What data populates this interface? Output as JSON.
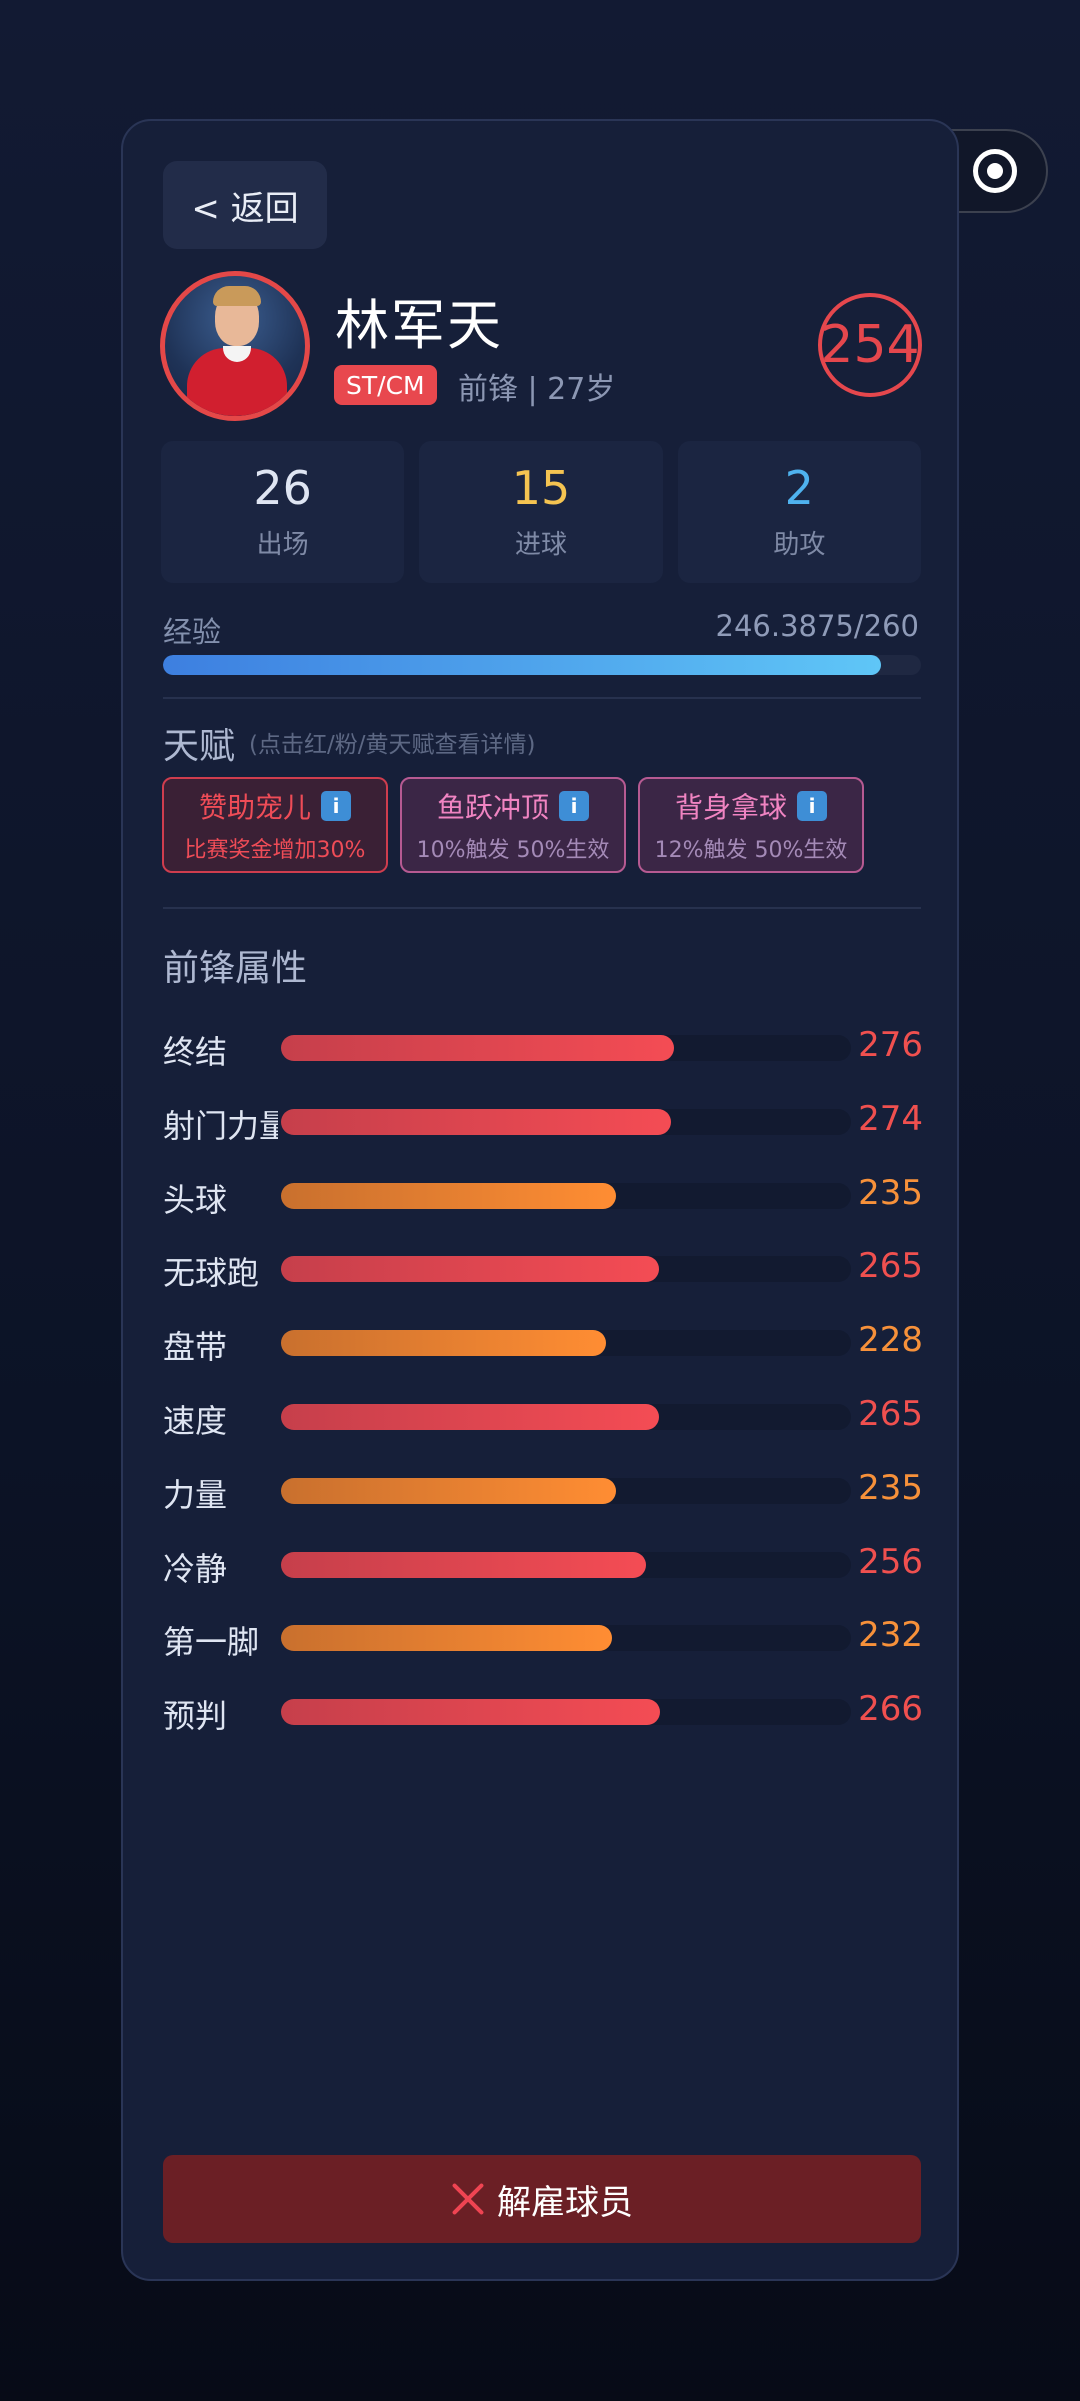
{
  "header": {
    "back_label": "< 返回"
  },
  "player": {
    "name": "林军天",
    "position_badge": "ST/CM",
    "meta": "前锋 | 27岁",
    "rating": "254"
  },
  "stats": [
    {
      "value": "26",
      "label": "出场",
      "color": "#dfe5f2"
    },
    {
      "value": "15",
      "label": "进球",
      "color": "#f5c451"
    },
    {
      "value": "2",
      "label": "助攻",
      "color": "#4fb2ee"
    }
  ],
  "experience": {
    "label": "经验",
    "value_text": "246.3875/260",
    "progress": 0.9476
  },
  "talents": {
    "title": "天赋",
    "hint": "(点击红/粉/黄天赋查看详情)",
    "items": [
      {
        "name": "赞助宠儿",
        "desc": "比赛奖金增加30%",
        "color": "red",
        "icon": "info-icon"
      },
      {
        "name": "鱼跃冲顶",
        "desc": "10%触发 50%生效",
        "color": "pink",
        "icon": "info-icon"
      },
      {
        "name": "背身拿球",
        "desc": "12%触发 50%生效",
        "color": "pink",
        "icon": "info-icon"
      }
    ]
  },
  "attributes": {
    "title": "前锋属性",
    "items": [
      {
        "name": "终结",
        "value": 276,
        "tier": "red"
      },
      {
        "name": "射门力量",
        "value": 274,
        "tier": "red"
      },
      {
        "name": "头球",
        "value": 235,
        "tier": "orange"
      },
      {
        "name": "无球跑",
        "value": 265,
        "tier": "red"
      },
      {
        "name": "盘带",
        "value": 228,
        "tier": "orange"
      },
      {
        "name": "速度",
        "value": 265,
        "tier": "red"
      },
      {
        "name": "力量",
        "value": 235,
        "tier": "orange"
      },
      {
        "name": "冷静",
        "value": 256,
        "tier": "red"
      },
      {
        "name": "第一脚",
        "value": 232,
        "tier": "orange"
      },
      {
        "name": "预判",
        "value": 266,
        "tier": "red"
      }
    ]
  },
  "actions": {
    "fire_label": "解雇球员"
  },
  "colors": {
    "accent_red": "#e5474d",
    "accent_orange": "#f7913a",
    "exp_blue": "#4fa6ec"
  }
}
